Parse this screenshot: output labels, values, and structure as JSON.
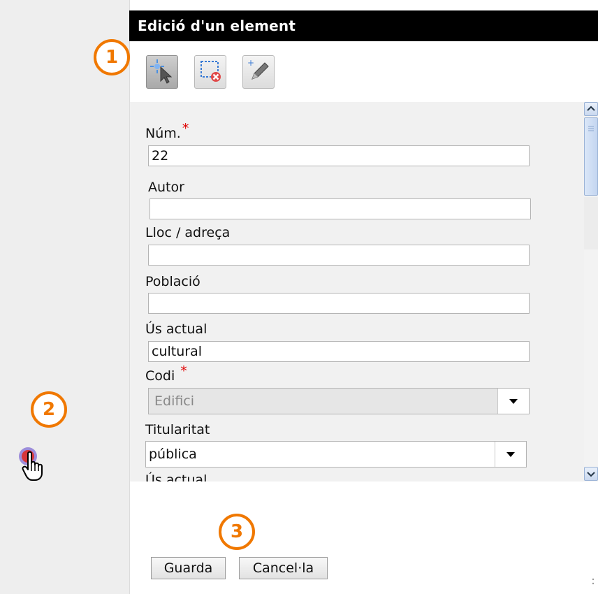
{
  "window": {
    "title": "Edició d'un element"
  },
  "toolbar": {
    "tools": [
      {
        "icon": "select-arrow-icon",
        "state": "active"
      },
      {
        "icon": "delete-selection-icon"
      },
      {
        "icon": "edit-pencil-icon"
      }
    ]
  },
  "form": {
    "num": {
      "label": "Núm.",
      "required_mark": "*",
      "value": "22"
    },
    "autor": {
      "label": "Autor",
      "value": ""
    },
    "lloc": {
      "label": "Lloc / adreça",
      "value": ""
    },
    "poblacio": {
      "label": "Població",
      "value": ""
    },
    "us_actual": {
      "label": "Ús actual",
      "value": "cultural"
    },
    "codi": {
      "label": "Codi",
      "required_mark": "*",
      "value": "Edifici",
      "disabled": true
    },
    "titularitat": {
      "label": "Titularitat",
      "value": "pública"
    },
    "us_actual_2": {
      "label": "Ús actual"
    }
  },
  "buttons": {
    "save": "Guarda",
    "cancel": "Cancel·la"
  },
  "callouts": [
    "1",
    "2",
    "3"
  ],
  "colors": {
    "callout": "#f07800",
    "required": "#e00000",
    "title_bar": "#000000"
  }
}
